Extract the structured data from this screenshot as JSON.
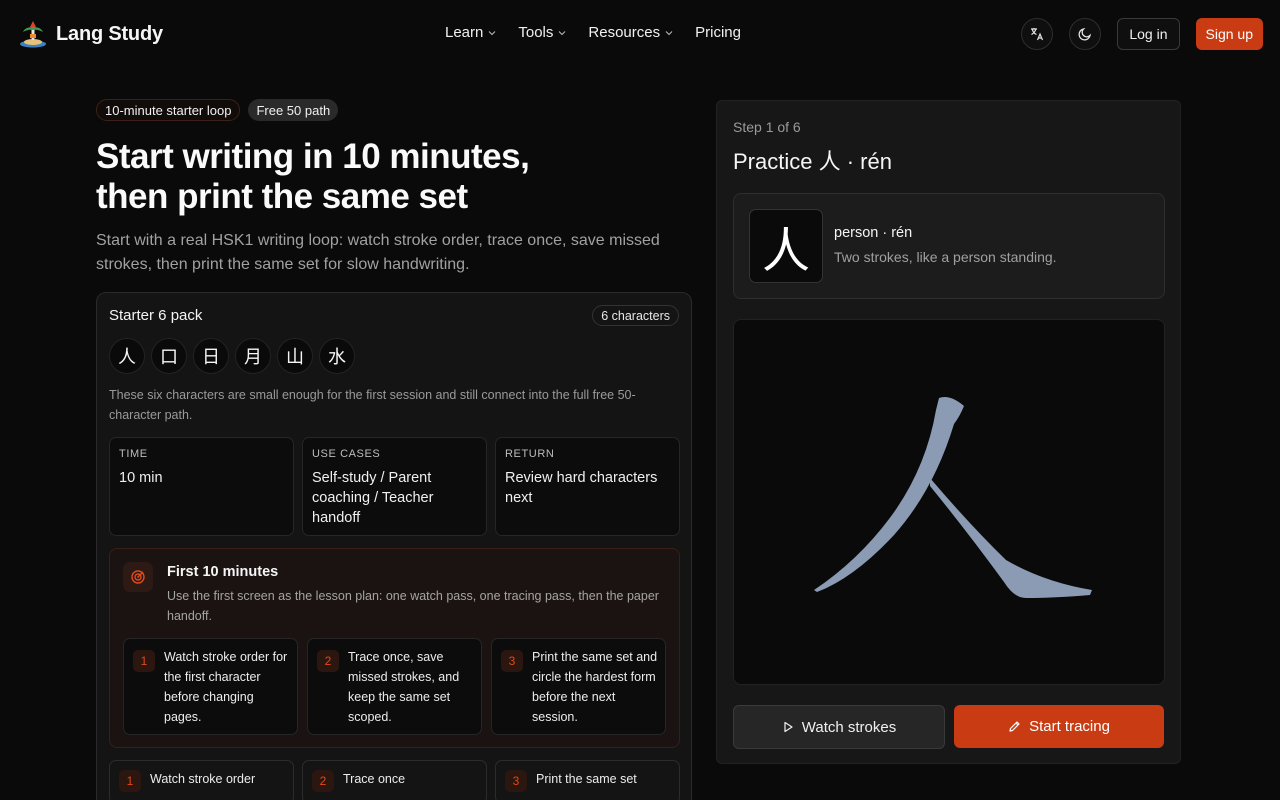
{
  "header": {
    "brand": "Lang Study",
    "nav": [
      {
        "label": "Learn",
        "has_menu": true
      },
      {
        "label": "Tools",
        "has_menu": true
      },
      {
        "label": "Resources",
        "has_menu": true
      },
      {
        "label": "Pricing",
        "has_menu": false
      }
    ],
    "login": "Log in",
    "signup": "Sign up",
    "icons": [
      "language-icon",
      "moon-icon"
    ]
  },
  "hero": {
    "tags": [
      "10-minute starter loop",
      "Free 50 path"
    ],
    "title_line1": "Start writing in 10 minutes,",
    "title_line2": "then print the same set",
    "subtitle": "Start with a real HSK1 writing loop: watch stroke order, trace once, save missed strokes, then print the same set for slow handwriting."
  },
  "pack": {
    "title": "Starter 6 pack",
    "count": "6 characters",
    "characters": [
      "人",
      "口",
      "日",
      "月",
      "山",
      "水"
    ],
    "description": "These six characters are small enough for the first session and still connect into the full free 50-character path.",
    "stats": [
      {
        "label": "TIME",
        "value": "10 min"
      },
      {
        "label": "USE CASES",
        "value": "Self-study / Parent coaching / Teacher handoff"
      },
      {
        "label": "RETURN",
        "value": "Review hard characters next"
      }
    ],
    "first10": {
      "title": "First 10 minutes",
      "description": "Use the first screen as the lesson plan: one watch pass, one tracing pass, then the paper handoff.",
      "steps": [
        {
          "num": "1",
          "text": "Watch stroke order for the first character before changing pages."
        },
        {
          "num": "2",
          "text": "Trace once, save missed strokes, and keep the same set scoped."
        },
        {
          "num": "3",
          "text": "Print the same set and circle the hardest form before the next session."
        }
      ]
    },
    "bottom_steps": [
      {
        "num": "1",
        "text": "Watch stroke order"
      },
      {
        "num": "2",
        "text": "Trace once"
      },
      {
        "num": "3",
        "text": "Print the same set"
      }
    ]
  },
  "practice": {
    "step": "Step 1 of 6",
    "title": "Practice 人 · rén",
    "character": "人",
    "gloss": "person · rén",
    "description": "Two strokes, like a person standing.",
    "watch_label": "Watch strokes",
    "trace_label": "Start tracing",
    "stroke_color": "#8b9bb4",
    "accent": "#c93b12"
  }
}
